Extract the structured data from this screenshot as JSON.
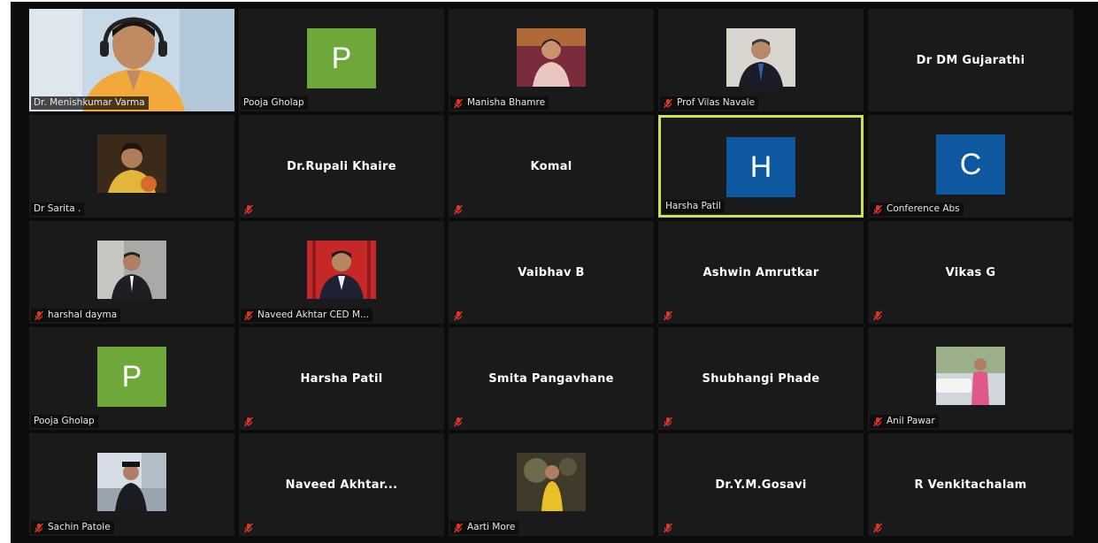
{
  "meeting": {
    "accent_color": "#c8e05a",
    "muted_icon_color": "#e0352b",
    "participants": [
      {
        "name": "Dr. Menishkumar Varma",
        "kind": "video",
        "muted": false
      },
      {
        "name": "Pooja Gholap",
        "kind": "avatar",
        "initial": "P",
        "avatar_color": "#6fa83a",
        "muted": false
      },
      {
        "name": "Manisha Bhamre",
        "kind": "photo",
        "muted": true
      },
      {
        "name": "Prof Vilas Navale",
        "kind": "photo",
        "muted": true
      },
      {
        "name": "Dr DM Gujarathi",
        "kind": "name",
        "muted": false,
        "show_label": false
      },
      {
        "name": "Dr Sarita",
        "label": "Dr Sarita .",
        "kind": "photo",
        "muted": false
      },
      {
        "name": "Dr.Rupali Khaire",
        "kind": "name",
        "muted": true
      },
      {
        "name": "Komal",
        "kind": "name",
        "muted": true
      },
      {
        "name": "Harsha Patil",
        "kind": "avatar",
        "initial": "H",
        "avatar_color": "#0e58a0",
        "muted": false,
        "active_speaker": true
      },
      {
        "name": "Conference Abs",
        "kind": "avatar",
        "initial": "C",
        "avatar_color": "#0e58a0",
        "muted": true
      },
      {
        "name": "harshal dayma",
        "kind": "photo",
        "muted": true
      },
      {
        "name": "Naveed Akhtar CED M...",
        "kind": "photo",
        "muted": true
      },
      {
        "name": "Vaibhav B",
        "kind": "name",
        "muted": true
      },
      {
        "name": "Ashwin Amrutkar",
        "kind": "name",
        "muted": true
      },
      {
        "name": "Vikas G",
        "kind": "name",
        "muted": true
      },
      {
        "name": "Pooja Gholap",
        "kind": "avatar",
        "initial": "P",
        "avatar_color": "#6fa83a",
        "muted": false
      },
      {
        "name": "Harsha Patil",
        "kind": "name",
        "muted": true
      },
      {
        "name": "Smita Pangavhane",
        "kind": "name",
        "muted": true
      },
      {
        "name": "Shubhangi Phade",
        "kind": "name",
        "muted": true
      },
      {
        "name": "Anil Pawar",
        "kind": "photo",
        "muted": true
      },
      {
        "name": "Sachin Patole",
        "kind": "photo",
        "muted": true
      },
      {
        "name": "Naveed Akhtar...",
        "kind": "name",
        "muted": true
      },
      {
        "name": "Aarti More",
        "kind": "photo",
        "muted": true
      },
      {
        "name": "Dr.Y.M.Gosavi",
        "kind": "name",
        "muted": true
      },
      {
        "name": "R Venkitachalam",
        "kind": "name",
        "muted": true
      }
    ]
  }
}
